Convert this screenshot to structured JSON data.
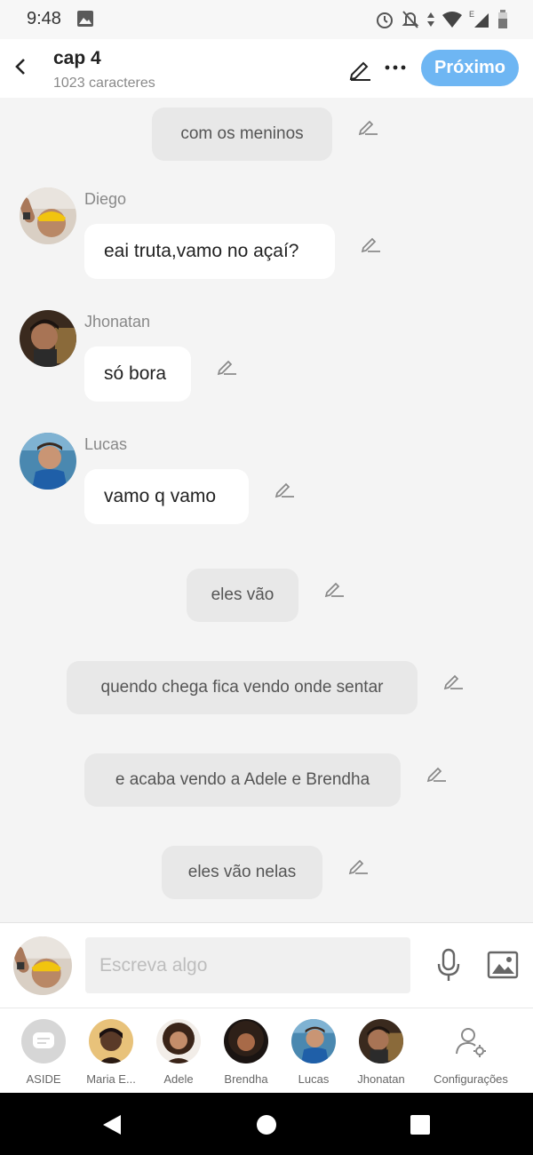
{
  "status_bar": {
    "time": "9:48"
  },
  "header": {
    "title": "cap 4",
    "subtitle": "1023 caracteres",
    "next_label": "Próximo"
  },
  "messages": [
    {
      "type": "narration",
      "text": "com os meninos"
    },
    {
      "type": "dialogue",
      "speaker": "Diego",
      "text": "eai truta,vamo no açaí?"
    },
    {
      "type": "dialogue",
      "speaker": "Jhonatan",
      "text": "só bora"
    },
    {
      "type": "dialogue",
      "speaker": "Lucas",
      "text": "vamo q vamo"
    },
    {
      "type": "narration",
      "text": "eles vão"
    },
    {
      "type": "narration",
      "text": "quendo chega fica vendo onde sentar"
    },
    {
      "type": "narration",
      "text": "e acaba vendo a Adele e Brendha"
    },
    {
      "type": "narration",
      "text": "eles vão nelas"
    }
  ],
  "composer": {
    "placeholder": "Escreva algo",
    "value": ""
  },
  "characters": [
    {
      "name": "ASIDE"
    },
    {
      "name": "Maria E..."
    },
    {
      "name": "Adele"
    },
    {
      "name": "Brendha"
    },
    {
      "name": "Lucas"
    },
    {
      "name": "Jhonatan"
    },
    {
      "name": "Configurações"
    }
  ],
  "icons": {
    "back": "arrow-left-icon",
    "edit": "pencil-icon",
    "more": "more-horizontal-icon",
    "mic": "microphone-icon",
    "image": "image-icon",
    "aside": "chat-bubble-icon",
    "settings": "user-gear-icon",
    "nav_back": "triangle-back-icon",
    "nav_home": "circle-home-icon",
    "nav_recents": "square-recents-icon"
  },
  "colors": {
    "accent": "#6eb6f3",
    "bubble": "#ffffff",
    "narration": "#e8e8e8",
    "background": "#f4f4f4"
  }
}
